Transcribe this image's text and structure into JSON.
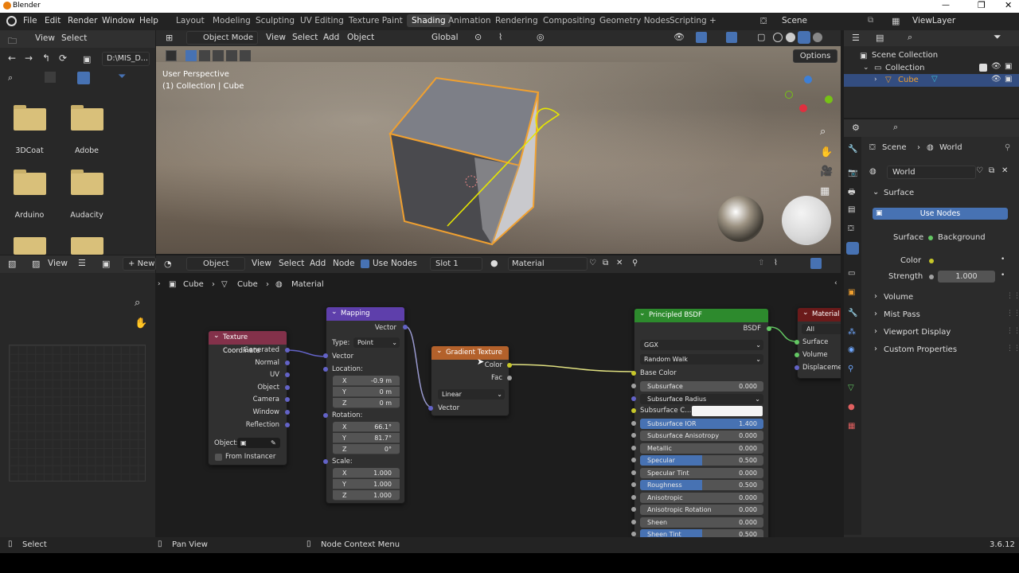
{
  "window": {
    "title": "Blender"
  },
  "menu": {
    "file": "File",
    "edit": "Edit",
    "render": "Render",
    "window": "Window",
    "help": "Help"
  },
  "workspaces": [
    "Layout",
    "Modeling",
    "Sculpting",
    "UV Editing",
    "Texture Paint",
    "Shading",
    "Animation",
    "Rendering",
    "Compositing",
    "Geometry Nodes",
    "Scripting"
  ],
  "active_workspace": "Shading",
  "add_workspace": "+",
  "scene": {
    "name": "Scene",
    "view_layer": "ViewLayer"
  },
  "file_browser": {
    "view": "View",
    "select": "Select",
    "path": "D:\\MIS_D...",
    "folders": [
      "3DCoat",
      "Adobe",
      "Arduino",
      "Audacity"
    ]
  },
  "viewport": {
    "mode": "Object Mode",
    "view": "View",
    "select": "Select",
    "add": "Add",
    "object": "Object",
    "orientation": "Global",
    "options": "Options",
    "perspective": "User Perspective",
    "context": "(1) Collection | Cube"
  },
  "outliner": {
    "scene_collection": "Scene Collection",
    "collection": "Collection",
    "cube": "Cube"
  },
  "properties": {
    "breadcrumb_scene": "Scene",
    "breadcrumb_world": "World",
    "world_name": "World",
    "surface_panel": "Surface",
    "use_nodes": "Use Nodes",
    "surface_label": "Surface",
    "surface_value": "Background",
    "color_label": "Color",
    "strength_label": "Strength",
    "strength_value": "1.000",
    "panels": [
      "Volume",
      "Mist Pass",
      "Viewport Display",
      "Custom Properties"
    ]
  },
  "image_editor": {
    "view": "View",
    "new": "New"
  },
  "node_editor": {
    "object": "Object",
    "view": "View",
    "select": "Select",
    "add": "Add",
    "node": "Node",
    "use_nodes": "Use Nodes",
    "slot": "Slot 1",
    "material": "Material",
    "breadcrumb": [
      "Cube",
      "Cube",
      "Material"
    ]
  },
  "nodes": {
    "tex_coord": {
      "title": "Texture Coordinate",
      "outputs": [
        "Generated",
        "Normal",
        "UV",
        "Object",
        "Camera",
        "Window",
        "Reflection"
      ],
      "object_label": "Object:",
      "from_instancer": "From Instancer"
    },
    "mapping": {
      "title": "Mapping",
      "vector_out": "Vector",
      "type_label": "Type:",
      "type_value": "Point",
      "vector_in": "Vector",
      "location": "Location:",
      "rotation": "Rotation:",
      "scale": "Scale:",
      "loc": [
        {
          "axis": "X",
          "value": "-0.9 m"
        },
        {
          "axis": "Y",
          "value": "0 m"
        },
        {
          "axis": "Z",
          "value": "0 m"
        }
      ],
      "rot": [
        {
          "axis": "X",
          "value": "66.1°"
        },
        {
          "axis": "Y",
          "value": "81.7°"
        },
        {
          "axis": "Z",
          "value": "0°"
        }
      ],
      "scl": [
        {
          "axis": "X",
          "value": "1.000"
        },
        {
          "axis": "Y",
          "value": "1.000"
        },
        {
          "axis": "Z",
          "value": "1.000"
        }
      ]
    },
    "gradient": {
      "title": "Gradient Texture",
      "color": "Color",
      "fac": "Fac",
      "type": "Linear",
      "vector": "Vector"
    },
    "bsdf": {
      "title": "Principled BSDF",
      "bsdf_out": "BSDF",
      "distribution": "GGX",
      "subsurface_method": "Random Walk",
      "base_color": "Base Color",
      "rows": [
        {
          "label": "Subsurface",
          "value": "0.000",
          "fill": 0
        },
        {
          "label": "Subsurface Radius",
          "value": "",
          "fill": 0
        },
        {
          "label": "Subsurface C...",
          "value": "",
          "fill": 0
        },
        {
          "label": "Subsurface IOR",
          "value": "1.400",
          "fill": 1
        },
        {
          "label": "Subsurface Anisotropy",
          "value": "0.000",
          "fill": 0
        },
        {
          "label": "Metallic",
          "value": "0.000",
          "fill": 0
        },
        {
          "label": "Specular",
          "value": "0.500",
          "fill": 0.5
        },
        {
          "label": "Specular Tint",
          "value": "0.000",
          "fill": 0
        },
        {
          "label": "Roughness",
          "value": "0.500",
          "fill": 0.5
        },
        {
          "label": "Anisotropic",
          "value": "0.000",
          "fill": 0
        },
        {
          "label": "Anisotropic Rotation",
          "value": "0.000",
          "fill": 0
        },
        {
          "label": "Sheen",
          "value": "0.000",
          "fill": 0
        },
        {
          "label": "Sheen Tint",
          "value": "0.500",
          "fill": 0.5
        }
      ]
    },
    "output": {
      "title": "Material O",
      "target": "All",
      "surface": "Surface",
      "volume": "Volume",
      "displacement": "Displacemen"
    }
  },
  "status": {
    "select": "Select",
    "pan": "Pan View",
    "context": "Node Context Menu",
    "version": "3.6.12"
  },
  "colors": {
    "accent": "#4772b3",
    "selected_outline": "#f0a030",
    "tex_header": "#83314a",
    "vec_header": "#5e3fab",
    "gradient_header": "#b3612b",
    "shader_header": "#2d8a2d",
    "output_header": "#6b1a1a"
  }
}
